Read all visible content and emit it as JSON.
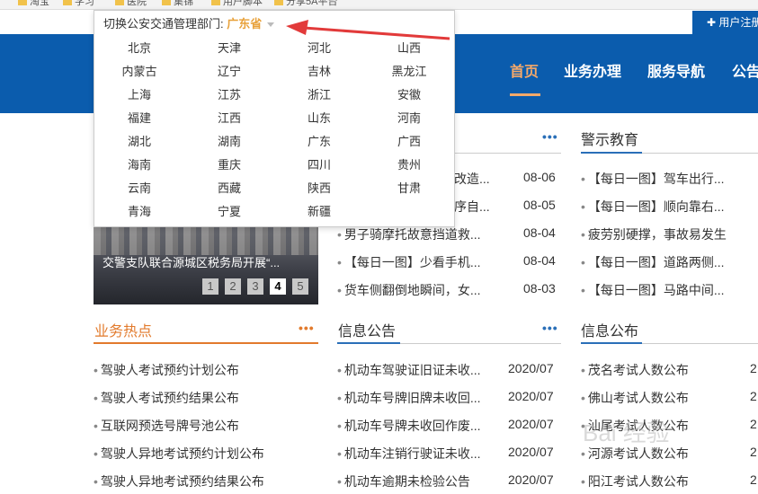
{
  "bookmarks": [
    "淘宝",
    "学习",
    "医院",
    "集锦",
    "用户脚本",
    "分享5A平台"
  ],
  "user_center": "用户注册",
  "nav": [
    "首页",
    "业务办理",
    "服务导航",
    "公告"
  ],
  "dropdown": {
    "label": "切换公安交通管理部门:",
    "current": "广东省",
    "provinces": [
      "北京",
      "天津",
      "河北",
      "山西",
      "内蒙古",
      "辽宁",
      "吉林",
      "黑龙江",
      "上海",
      "江苏",
      "浙江",
      "安徽",
      "福建",
      "江西",
      "山东",
      "河南",
      "湖北",
      "湖南",
      "广东",
      "广西",
      "海南",
      "重庆",
      "四川",
      "贵州",
      "云南",
      "西藏",
      "陕西",
      "甘肃",
      "青海",
      "宁夏",
      "新疆"
    ]
  },
  "news": {
    "more": "•••",
    "items": [
      {
        "title": "改造...",
        "date": "08-06"
      },
      {
        "title": "序自...",
        "date": "08-05"
      },
      {
        "title": "男子骑摩托故意挡道救...",
        "date": "08-04"
      },
      {
        "title": "【每日一图】少看手机...",
        "date": "08-04"
      },
      {
        "title": "货车侧翻倒地瞬间，女...",
        "date": "08-03"
      }
    ]
  },
  "warning": {
    "title": "警示教育",
    "items": [
      "【每日一图】驾车出行...",
      "【每日一图】顺向靠右...",
      "疲劳别硬撑，事故易发生",
      "【每日一图】道路两侧...",
      "【每日一图】马路中间..."
    ]
  },
  "carousel": {
    "caption": "交警支队联合源城区税务局开展“...",
    "pages": [
      "1",
      "2",
      "3",
      "4",
      "5"
    ],
    "active_page": "4"
  },
  "hot": {
    "title": "业务热点",
    "more": "•••",
    "items": [
      "驾驶人考试预约计划公布",
      "驾驶人考试预约结果公布",
      "互联网预选号牌号池公布",
      "驾驶人异地考试预约计划公布",
      "驾驶人异地考试预约结果公布"
    ]
  },
  "notice": {
    "title": "信息公告",
    "more": "•••",
    "items": [
      {
        "title": "机动车驾驶证旧证未收...",
        "date": "2020/07"
      },
      {
        "title": "机动车号牌旧牌未收回...",
        "date": "2020/07"
      },
      {
        "title": "机动车号牌未收回作废...",
        "date": "2020/07"
      },
      {
        "title": "机动车注销行驶证未收...",
        "date": "2020/07"
      },
      {
        "title": "机动车逾期未检验公告",
        "date": "2020/07"
      }
    ]
  },
  "publish": {
    "title": "信息公布",
    "items": [
      {
        "title": "茂名考试人数公布",
        "date": "2"
      },
      {
        "title": "佛山考试人数公布",
        "date": "2"
      },
      {
        "title": "汕尾考试人数公布",
        "date": "2"
      },
      {
        "title": "河源考试人数公布",
        "date": "2"
      },
      {
        "title": "阳江考试人数公布",
        "date": "2"
      }
    ]
  },
  "watermark": "Bai 经验",
  "colors": {
    "brand_blue": "#0b5cad",
    "accent_orange": "#e27a2c",
    "nav_active": "#f5a96a",
    "arrow_red": "#e23a3a"
  }
}
